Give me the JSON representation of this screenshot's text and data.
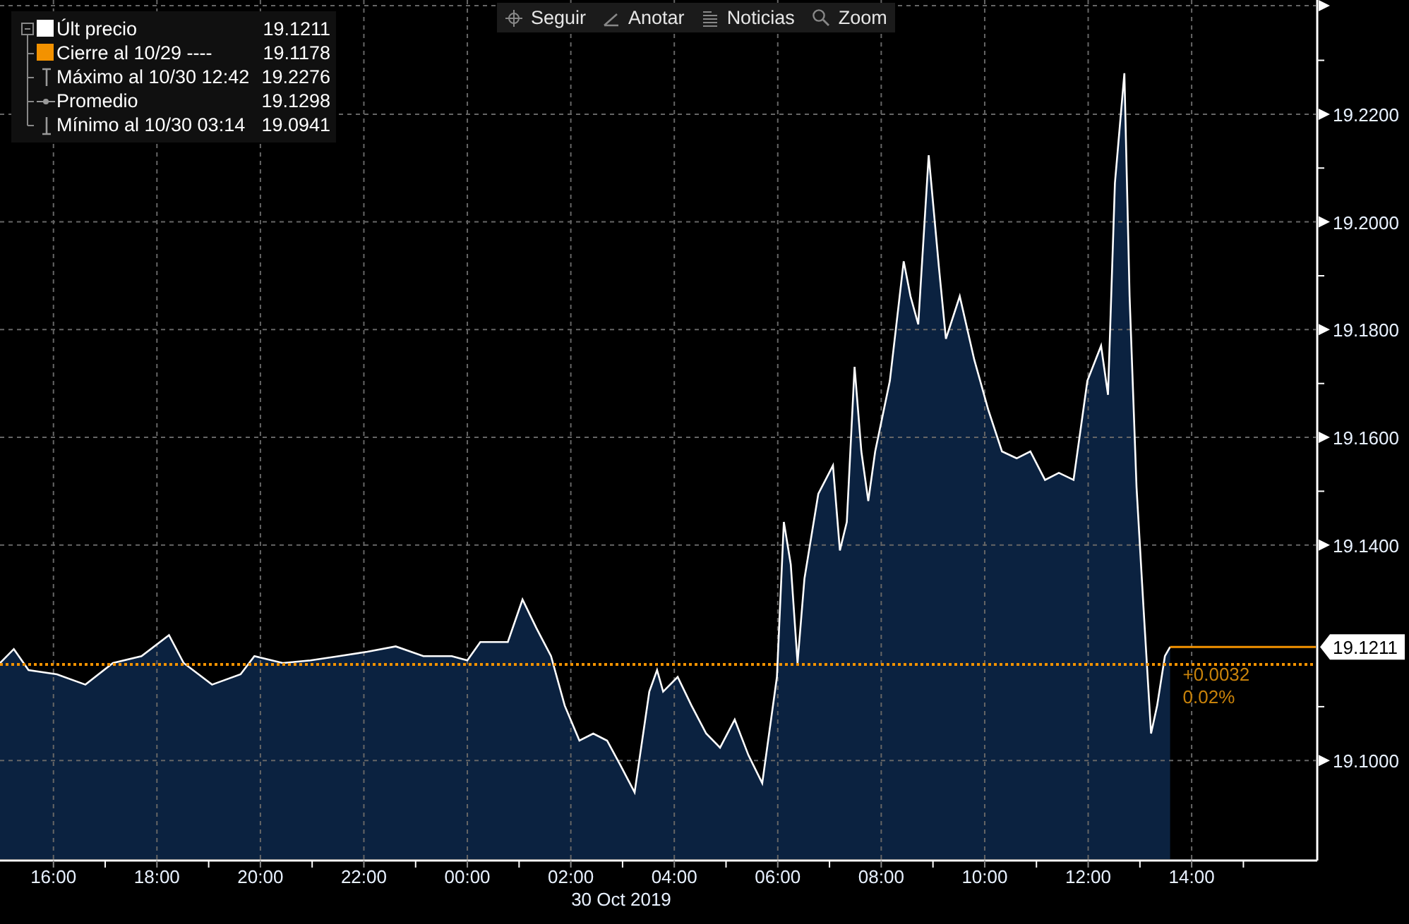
{
  "toolbar": [
    {
      "kind": "crosshair",
      "label": "Seguir"
    },
    {
      "kind": "pencil",
      "label": "Anotar"
    },
    {
      "kind": "news",
      "label": "Noticias"
    },
    {
      "kind": "magnifier",
      "label": "Zoom"
    }
  ],
  "legend": [
    {
      "kind": "last",
      "value": "19.1211",
      "color": "#ffffff"
    },
    {
      "kind": "close",
      "label": "Cierre al 10/29 ----",
      "value": "19.1178",
      "color": "#f39200"
    },
    {
      "kind": "high",
      "label": "Máximo al 10/30 12:42",
      "value": "19.2276"
    },
    {
      "kind": "average",
      "label": "Promedio",
      "value": "19.1298"
    },
    {
      "kind": "low",
      "label": "Mínimo al 10/30 03:14",
      "value": "19.0941"
    }
  ],
  "chart": {
    "last_price_tag": "19.1211",
    "change": "+0.0032",
    "change_pct": "0.02%",
    "date_label": "30 Oct 2019",
    "chart_data": {
      "type": "area",
      "grid": true,
      "x": [
        "2019-10-29T14:58",
        "2019-10-29T15:14",
        "2019-10-29T15:31",
        "2019-10-29T16:04",
        "2019-10-29T16:37",
        "2019-10-29T17:09",
        "2019-10-29T17:42",
        "2019-10-29T18:14",
        "2019-10-29T18:31",
        "2019-10-29T19:04",
        "2019-10-29T19:37",
        "2019-10-29T19:53",
        "2019-10-29T20:26",
        "2019-10-29T20:58",
        "2019-10-29T21:31",
        "2019-10-29T22:04",
        "2019-10-29T22:37",
        "2019-10-29T23:09",
        "2019-10-29T23:42",
        "2019-10-30T00:00",
        "2019-10-30T00:15",
        "2019-10-30T00:47",
        "2019-10-30T01:04",
        "2019-10-30T01:20",
        "2019-10-30T01:37",
        "2019-10-30T01:53",
        "2019-10-30T02:10",
        "2019-10-30T02:26",
        "2019-10-30T02:42",
        "2019-10-30T02:58",
        "2019-10-30T03:14",
        "2019-10-30T03:31",
        "2019-10-30T03:40",
        "2019-10-30T03:47",
        "2019-10-30T04:04",
        "2019-10-30T04:20",
        "2019-10-30T04:37",
        "2019-10-30T04:53",
        "2019-10-30T05:10",
        "2019-10-30T05:26",
        "2019-10-30T05:42",
        "2019-10-30T05:59",
        "2019-10-30T06:07",
        "2019-10-30T06:15",
        "2019-10-30T06:23",
        "2019-10-30T06:31",
        "2019-10-30T06:47",
        "2019-10-30T07:04",
        "2019-10-30T07:12",
        "2019-10-30T07:20",
        "2019-10-30T07:29",
        "2019-10-30T07:37",
        "2019-10-30T07:45",
        "2019-10-30T07:53",
        "2019-10-30T08:10",
        "2019-10-30T08:26",
        "2019-10-30T08:34",
        "2019-10-30T08:43",
        "2019-10-30T08:50",
        "2019-10-30T08:55",
        "2019-10-30T09:07",
        "2019-10-30T09:15",
        "2019-10-30T09:31",
        "2019-10-30T09:48",
        "2019-10-30T10:04",
        "2019-10-30T10:20",
        "2019-10-30T10:37",
        "2019-10-30T10:53",
        "2019-10-30T11:10",
        "2019-10-30T11:26",
        "2019-10-30T11:43",
        "2019-10-30T11:59",
        "2019-10-30T12:15",
        "2019-10-30T12:23",
        "2019-10-30T12:31",
        "2019-10-30T12:42",
        "2019-10-30T12:48",
        "2019-10-30T12:56",
        "2019-10-30T13:04",
        "2019-10-30T13:13",
        "2019-10-30T13:20",
        "2019-10-30T13:29",
        "2019-10-30T13:35"
      ],
      "series": [
        {
          "name": "Últ precio",
          "color": "#ffffff",
          "values": [
            19.1181,
            19.1207,
            19.1168,
            19.116,
            19.1141,
            19.1181,
            19.1194,
            19.1233,
            19.1181,
            19.1141,
            19.116,
            19.1194,
            19.1181,
            19.1186,
            19.1194,
            19.1202,
            19.1212,
            19.1194,
            19.1194,
            19.1186,
            19.122,
            19.122,
            19.1299,
            19.1246,
            19.1194,
            19.1102,
            19.1037,
            19.105,
            19.1037,
            19.099,
            19.0941,
            19.1128,
            19.1168,
            19.1128,
            19.1155,
            19.1102,
            19.105,
            19.1024,
            19.1076,
            19.101,
            19.0958,
            19.1155,
            19.1443,
            19.1364,
            19.1181,
            19.1338,
            19.1495,
            19.1548,
            19.139,
            19.1443,
            19.1731,
            19.1574,
            19.1482,
            19.1574,
            19.1705,
            19.1927,
            19.1862,
            19.181,
            19.1993,
            19.2124,
            19.1914,
            19.1783,
            19.1862,
            19.1744,
            19.1652,
            19.1574,
            19.1561,
            19.1574,
            19.1521,
            19.1534,
            19.1521,
            19.1705,
            19.177,
            19.1679,
            19.2072,
            19.2276,
            19.1862,
            19.1508,
            19.1286,
            19.105,
            19.1102,
            19.1194,
            19.1211
          ]
        }
      ],
      "xlim": [
        "2019-10-29T14:58",
        "2019-10-30T16:24"
      ],
      "ylim": [
        19.0817,
        19.2412
      ],
      "xticks": [
        {
          "value": "2019-10-29T16:00",
          "label": "16:00"
        },
        {
          "value": "2019-10-29T18:00",
          "label": "18:00"
        },
        {
          "value": "2019-10-29T20:00",
          "label": "20:00"
        },
        {
          "value": "2019-10-29T22:00",
          "label": "22:00"
        },
        {
          "value": "2019-10-30T00:00",
          "label": "00:00"
        },
        {
          "value": "2019-10-30T02:00",
          "label": "02:00"
        },
        {
          "value": "2019-10-30T04:00",
          "label": "04:00"
        },
        {
          "value": "2019-10-30T06:00",
          "label": "06:00"
        },
        {
          "value": "2019-10-30T08:00",
          "label": "08:00"
        },
        {
          "value": "2019-10-30T10:00",
          "label": "10:00"
        },
        {
          "value": "2019-10-30T12:00",
          "label": "12:00"
        },
        {
          "value": "2019-10-30T14:00",
          "label": "14:00"
        }
      ],
      "yticks": [
        {
          "value": 19.1,
          "label": "19.1000"
        },
        {
          "value": 19.14,
          "label": "19.1400"
        },
        {
          "value": 19.16,
          "label": "19.1600"
        },
        {
          "value": 19.18,
          "label": "19.1800"
        },
        {
          "value": 19.2,
          "label": "19.2000"
        },
        {
          "value": 19.22,
          "label": "19.2200"
        }
      ]
    }
  }
}
